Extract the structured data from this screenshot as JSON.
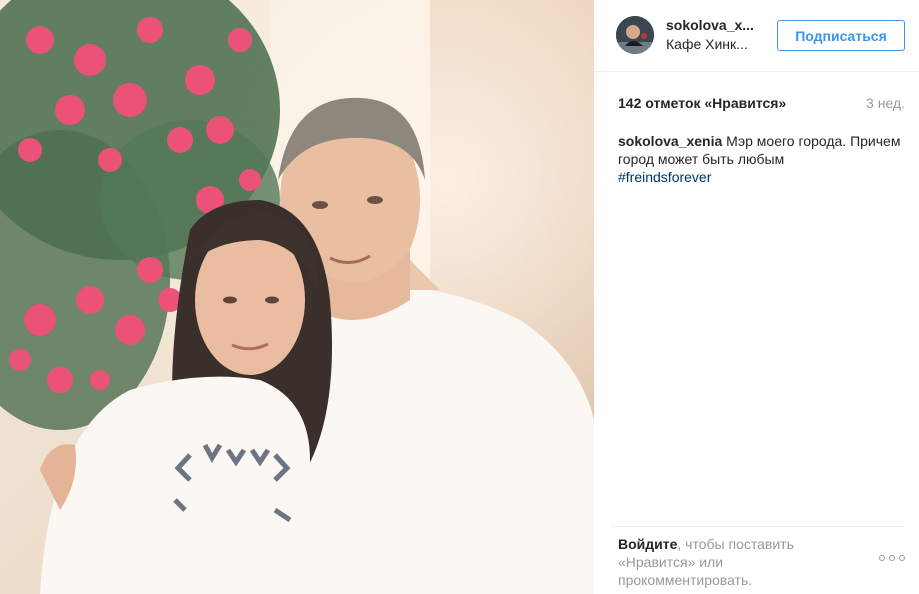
{
  "post": {
    "image_alt": "Photo"
  },
  "header": {
    "username": "sokolova_x...",
    "location": "Кафе Хинк...",
    "follow_label": "Подписаться"
  },
  "stats": {
    "likes": "142 отметок «Нравится»",
    "time_ago": "3 нед."
  },
  "caption": {
    "username": "sokolova_xenia",
    "text": "Мэр моего города. Причем город может быть любым",
    "hashtag": "#freindsforever"
  },
  "footer": {
    "login_link": "Войдите",
    "login_rest": ", чтобы поставить «Нравится» или прокомментировать.",
    "more_icon": "ellipsis-icon"
  },
  "colors": {
    "accent": "#3897f0",
    "hashtag": "#003569",
    "muted": "#999999",
    "text": "#262626",
    "flowers": "#e83e6c"
  }
}
